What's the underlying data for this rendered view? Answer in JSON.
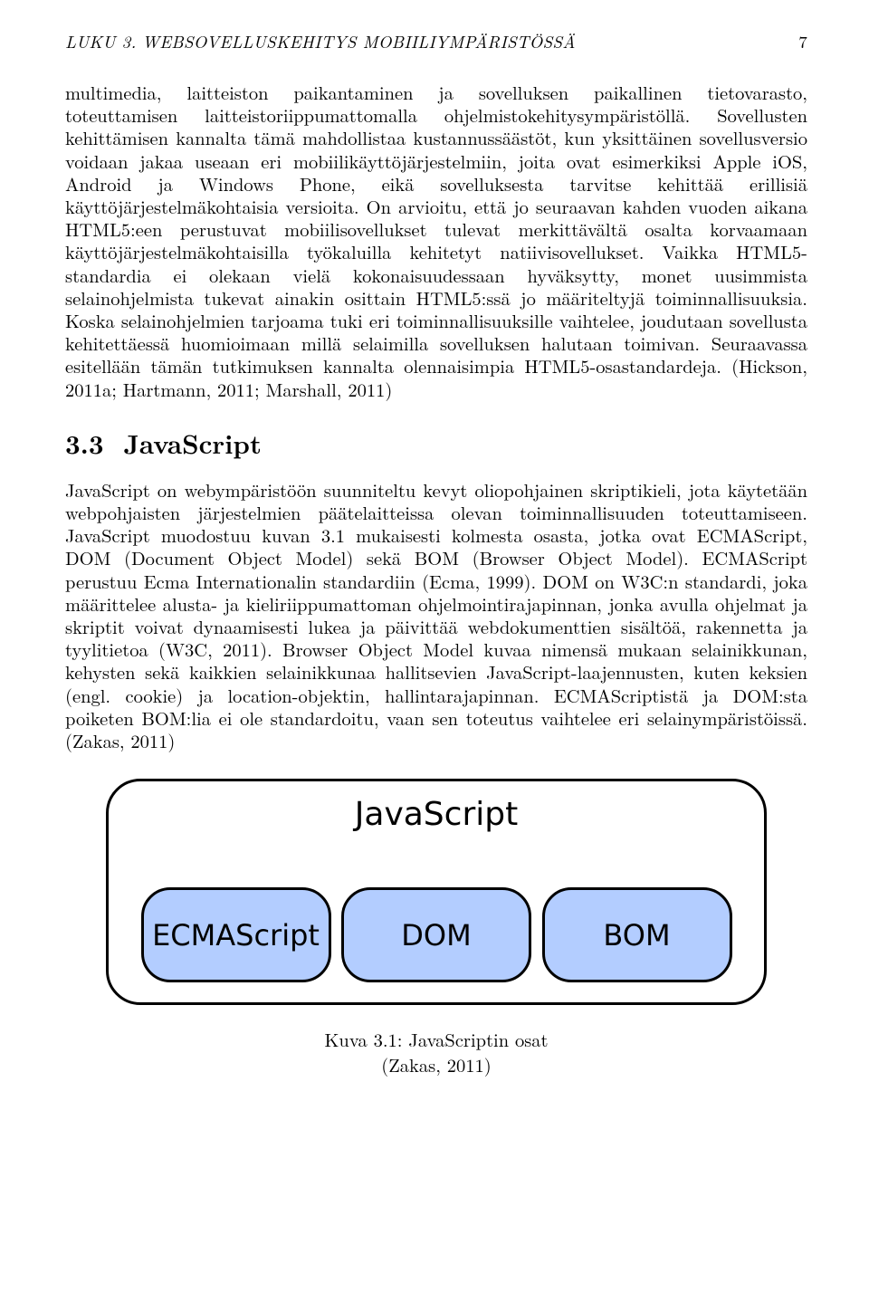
{
  "header": {
    "chapter_label": "LUKU 3.",
    "chapter_title": "WEBSOVELLUSKEHITYS MOBIILIYMPÄRISTÖSSÄ",
    "page_number": "7"
  },
  "paragraphs": {
    "p1": "multimedia, laitteiston paikantaminen ja sovelluksen paikallinen tietovarasto, toteuttamisen laitteistoriippumattomalla ohjelmistokehitysympäristöllä. Sovellusten kehittämisen kannalta tämä mahdollistaa kustannussäästöt, kun yksittäinen sovellusversio voidaan jakaa useaan eri mobiilikäyttöjärjestelmiin, joita ovat esimerkiksi Apple iOS, Android ja Windows Phone, eikä sovelluksesta tarvitse kehittää erillisiä käyttöjärjestelmäkohtaisia versioita. On arvioitu, että jo seuraavan kahden vuoden aikana HTML5:een perustuvat mobiilisovellukset tulevat merkittävältä osalta korvaamaan käyttöjärjestelmäkohtaisilla työkaluilla kehitetyt natiivisovellukset. Vaikka HTML5-standardia ei olekaan vielä kokonaisuudessaan hyväksytty, monet uusimmista selainohjelmista tukevat ainakin osittain HTML5:ssä jo määriteltyjä toiminnallisuuksia. Koska selainohjelmien tarjoama tuki eri toiminnallisuuksille vaihtelee, joudutaan sovellusta kehitettäessä huomioimaan millä selaimilla sovelluksen halutaan toimivan. Seuraavassa esitellään tämän tutkimuksen kannalta olennaisimpia HTML5-osastandardeja. (Hickson, 2011a; Hartmann, 2011; Marshall, 2011)"
  },
  "section": {
    "number": "3.3",
    "title": "JavaScript"
  },
  "paragraphs2": {
    "p2": "JavaScript on webympäristöön suunniteltu kevyt oliopohjainen skriptikieli, jota käytetään webpohjaisten järjestelmien päätelaitteissa olevan toiminnallisuuden toteuttamiseen. JavaScript muodostuu kuvan 3.1 mukaisesti kolmesta osasta, jotka ovat ECMAScript, DOM (Document Object Model) sekä BOM (Browser Object Model). ECMAScript perustuu Ecma Internationalin standardiin (Ecma, 1999). DOM on W3C:n standardi, joka määrittelee alusta- ja kieliriippumattoman ohjelmointirajapinnan, jonka avulla ohjelmat ja skriptit voivat dynaamisesti lukea ja päivittää webdokumenttien sisältöä, rakennetta ja tyylitietoa (W3C, 2011). Browser Object Model kuvaa nimensä mukaan selainikkunan, kehysten sekä kaikkien selainikkunaa hallitsevien JavaScript-laajennusten, kuten keksien (engl. cookie) ja location-objektin, hallintarajapinnan. ECMAScriptistä ja DOM:sta poiketen BOM:lia ei ole standardoitu, vaan sen toteutus vaihtelee eri selainympäristöissä. (Zakas, 2011)"
  },
  "chart_data": {
    "type": "diagram",
    "title": "JavaScript",
    "children": [
      "ECMAScript",
      "DOM",
      "BOM"
    ]
  },
  "caption": {
    "line1": "Kuva 3.1: JavaScriptin osat",
    "line2": "(Zakas, 2011)"
  }
}
